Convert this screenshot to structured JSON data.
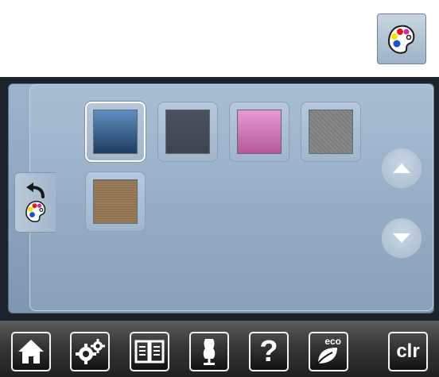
{
  "header": {
    "palette_icon": "palette-icon"
  },
  "side_tab": {
    "back_icon": "back-arrow-icon",
    "palette_icon": "palette-icon"
  },
  "swatches": [
    {
      "name": "blue-gradient",
      "colors": [
        "#5d8fc2",
        "#1f3c5c"
      ],
      "selected": true
    },
    {
      "name": "dark-gray",
      "colors": [
        "#4a525d",
        "#3d4450"
      ],
      "selected": false
    },
    {
      "name": "pink-gradient",
      "colors": [
        "#e69bd0",
        "#b45a98"
      ],
      "selected": false
    },
    {
      "name": "gray-texture",
      "colors": [
        "#8a8a88",
        "#787876"
      ],
      "selected": false
    },
    {
      "name": "beige-texture",
      "colors": [
        "#c9b49a",
        "#b7a288"
      ],
      "selected": false
    }
  ],
  "scroll": {
    "up_icon": "arrow-up-icon",
    "down_icon": "arrow-down-icon"
  },
  "bottom_bar": {
    "home_icon": "home-icon",
    "settings_icon": "gears-icon",
    "manual_icon": "book-icon",
    "tutorial_icon": "dress-form-icon",
    "help_label": "?",
    "eco_label": "eco",
    "clr_label": "clr"
  },
  "colors": {
    "frame": "#1c232b",
    "panel": "#94abc3",
    "bottom_bar": "#2a2a2a"
  }
}
